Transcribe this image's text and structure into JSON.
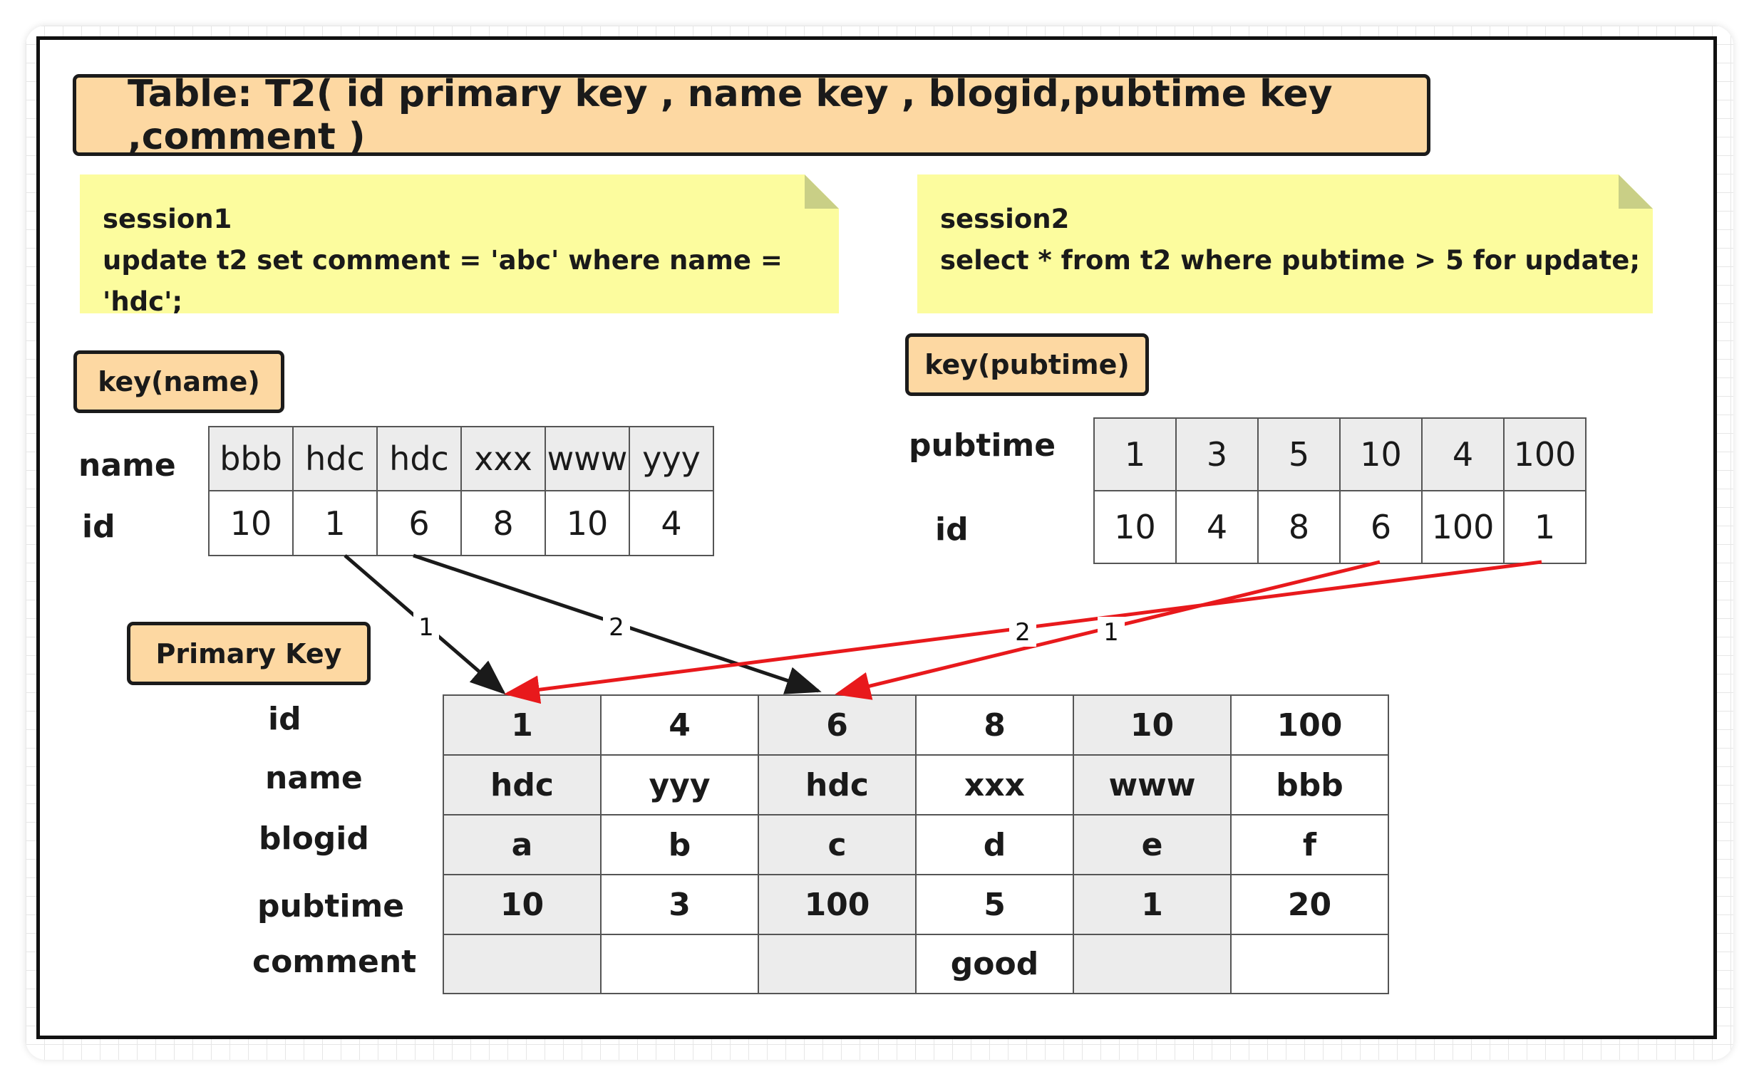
{
  "title": "Table: T2( id primary key , name key , blogid,pubtime key ,comment )",
  "session1": {
    "name": "session1",
    "sql": "update t2 set comment = 'abc' where name = 'hdc';"
  },
  "session2": {
    "name": "session2",
    "sql": "select * from t2 where pubtime > 5 for update;"
  },
  "key_name": {
    "label": "key(name)",
    "row_labels": [
      "name",
      "id"
    ],
    "names": [
      "bbb",
      "hdc",
      "hdc",
      "xxx",
      "www",
      "yyy"
    ],
    "ids": [
      "10",
      "1",
      "6",
      "8",
      "10",
      "4"
    ]
  },
  "key_pubtime": {
    "label": "key(pubtime)",
    "row_labels": [
      "pubtime",
      "id"
    ],
    "pubtimes": [
      "1",
      "3",
      "5",
      "10",
      "4",
      "100"
    ],
    "ids": [
      "10",
      "4",
      "8",
      "6",
      "100",
      "1"
    ]
  },
  "primary_key": {
    "label": "Primary Key",
    "row_labels": [
      "id",
      "name",
      "blogid",
      "pubtime",
      "comment"
    ],
    "rows": [
      [
        "1",
        "4",
        "6",
        "8",
        "10",
        "100"
      ],
      [
        "hdc",
        "yyy",
        "hdc",
        "xxx",
        "www",
        "bbb"
      ],
      [
        "a",
        "b",
        "c",
        "d",
        "e",
        "f"
      ],
      [
        "10",
        "3",
        "100",
        "5",
        "1",
        "20"
      ],
      [
        "",
        "",
        "",
        "good",
        "",
        ""
      ]
    ]
  },
  "arrows": {
    "black_1": "1",
    "black_2": "2",
    "red_1": "1",
    "red_2": "2"
  },
  "colors": {
    "box_fill": "#fdd8a2",
    "note_fill": "#fcfc9e",
    "cell_grey": "#ececec",
    "arrow_black": "#1a1a1a",
    "arrow_red": "#e8191c"
  }
}
